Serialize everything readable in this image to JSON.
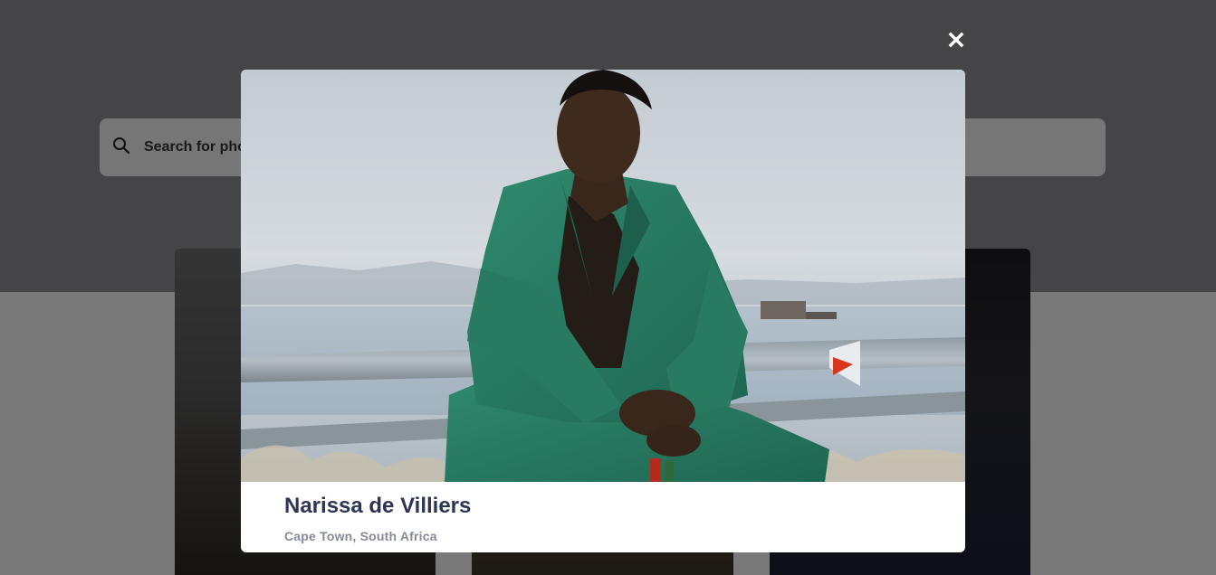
{
  "search": {
    "placeholder": "Search for photos"
  },
  "modal": {
    "close_icon": "close-icon",
    "photo": {
      "name": "Narissa de Villiers",
      "location": "Cape Town, South Africa"
    }
  },
  "colors": {
    "overlay": "rgba(0,0,0,0.5)",
    "name_text": "#2e3554",
    "location_text": "#868a99"
  }
}
